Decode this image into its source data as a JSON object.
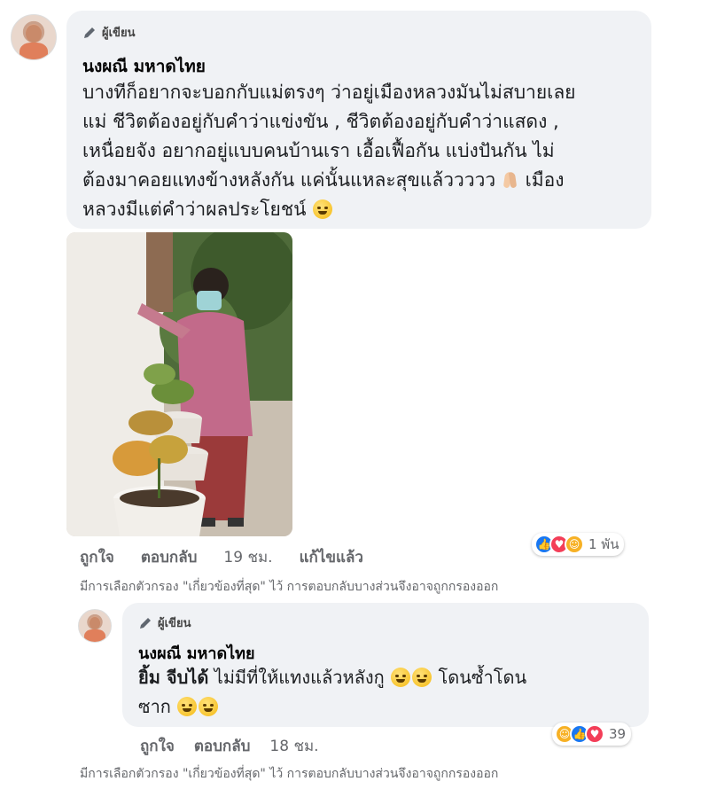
{
  "comment": {
    "badge": "ผู้เขียน",
    "author": "นงผณี มหาดไทย",
    "text_line1": "บางทีก็อยากจะบอกกับแม่ตรงๆ ว่าอยู่เมืองหลวงมันไม่สบายเลย",
    "text_line2": "แม่ ชีวิตต้องอยู่กับคำว่าแข่งขัน , ชีวิตต้องอยู่กับคำว่าแสดง ,",
    "text_line3": "เหนื่อยจัง อยากอยู่แบบคนบ้านเรา เอื้อเฟื้อกัน แบ่งปันกัน ไม่",
    "text_line4a": "ต้องมาคอยแทงข้างหลังกัน แค่นั้นแหละสุขแล้ววววว",
    "text_line4b": "เมือง",
    "text_line5": "หลวงมีแต่คำว่าผลประโยชน์",
    "actions": {
      "like": "ถูกใจ",
      "reply": "ตอบกลับ",
      "time": "19 ชม.",
      "edited": "แก้ไขแล้ว"
    },
    "reactions_count": "1 พัน"
  },
  "filter_note": "มีการเลือกตัวกรอง \"เกี่ยวข้องที่สุด\" ไว้ การตอบกลับบางส่วนจึงอาจถูกกรองออก",
  "reply": {
    "badge": "ผู้เขียน",
    "author": "นงผณี มหาดไทย",
    "mention": "ยิ้ม จีบได้",
    "text_line1": "ไม่มีที่ให้แทงแล้วหลังกู",
    "text_line1b": "โดนซ้ำโดน",
    "text_line2": "ซาก",
    "actions": {
      "like": "ถูกใจ",
      "reply": "ตอบกลับ",
      "time": "18 ชม."
    },
    "reactions_count": "39"
  },
  "colors": {
    "bubble": "#f0f2f5",
    "meta_text": "#65676b",
    "like_blue": "#1877f2",
    "love_red": "#f33e58",
    "care_yellow": "#f7b125"
  }
}
